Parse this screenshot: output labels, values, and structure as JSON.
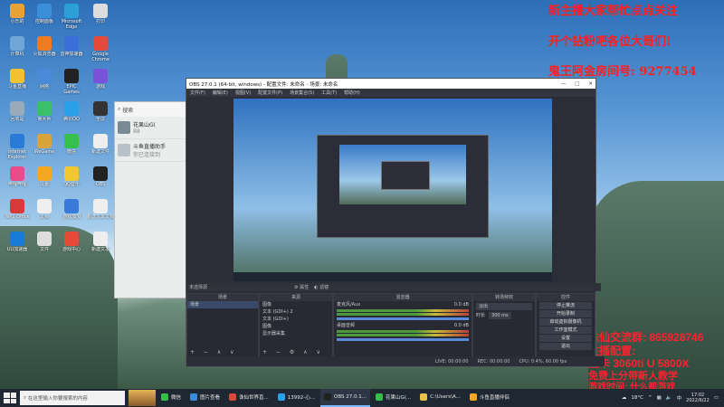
{
  "desktop": {
    "icons": [
      {
        "label": "小乐的",
        "color": "#e8a23a"
      },
      {
        "label": "控制面板",
        "color": "#3a8fd8"
      },
      {
        "label": "Microsoft Edge",
        "color": "#2c9fd8"
      },
      {
        "label": "打印",
        "color": "#ddd"
      },
      {
        "label": "计算机",
        "color": "#6fa6d8"
      },
      {
        "label": "火狐浏览器",
        "color": "#f07a22"
      },
      {
        "label": "雷神加速器",
        "color": "#3b6ed8"
      },
      {
        "label": "Google Chrome",
        "color": "#e64a3b"
      },
      {
        "label": "斗鱼直播",
        "color": "#f2c230"
      },
      {
        "label": "网络",
        "color": "#4a8ad8"
      },
      {
        "label": "EPIC Games Launcher",
        "color": "#222"
      },
      {
        "label": "游戏",
        "color": "#7a52d8"
      },
      {
        "label": "回收站",
        "color": "#9ab"
      },
      {
        "label": "鲁大师",
        "color": "#3ac06a"
      },
      {
        "label": "腾讯QQ",
        "color": "#2aa0e8"
      },
      {
        "label": "全屏",
        "color": "#333"
      },
      {
        "label": "Internet Explorer",
        "color": "#2a7ad8"
      },
      {
        "label": "WeGame",
        "color": "#d8a33a"
      },
      {
        "label": "微信",
        "color": "#36c04a"
      },
      {
        "label": "新建文件",
        "color": "#eee"
      },
      {
        "label": "哔哩哔哩",
        "color": "#e84a8a"
      },
      {
        "label": "斗鱼",
        "color": "#f5a623"
      },
      {
        "label": "QQ音乐",
        "color": "#f2c730"
      },
      {
        "label": "OBS",
        "color": "#222"
      },
      {
        "label": "WPS Office",
        "color": "#d83a3a"
      },
      {
        "label": "文档",
        "color": "#eee"
      },
      {
        "label": "游戏加加",
        "color": "#3a7ad8"
      },
      {
        "label": "新建文本文档",
        "color": "#eee"
      },
      {
        "label": "UU加速器",
        "color": "#1a7ad8"
      },
      {
        "label": "文件",
        "color": "#ddd"
      },
      {
        "label": "游戏中心",
        "color": "#e84a3a"
      },
      {
        "label": "新建文本",
        "color": "#eee"
      }
    ],
    "overlay_lines": [
      "新主播大家帮忙点点关注",
      "开个钻粉吧各位大哥们!",
      "鬼王阿金房间号: 9277454"
    ],
    "overlay_bottom": [
      "诛仙交流群: 865928746",
      "主播配置:",
      "显卡 3060ti U 5800X",
      "免费上分带新人教学",
      "游戏时间: 什么都游戏"
    ]
  },
  "chat_window": {
    "search_placeholder": "搜索",
    "items": [
      {
        "name": "花果山G(",
        "msg": "88"
      },
      {
        "name": "斗鱼直播助手",
        "msg": "你已连接到"
      }
    ]
  },
  "obs": {
    "title": "OBS 27.0.1 (64-bit, windows) - 配置文件: 未命名 - 场景: 未命名",
    "window_controls": [
      "—",
      "□",
      "✕"
    ],
    "menu": [
      "文件(F)",
      "编辑(E)",
      "视图(V)",
      "配置文件(P)",
      "场景集合(S)",
      "工具(T)",
      "帮助(H)"
    ],
    "source_bar": [
      "未选择源",
      "属性",
      "滤镜"
    ],
    "docks": {
      "scenes": {
        "title": "场景",
        "items": [
          "场景"
        ]
      },
      "sources": {
        "title": "来源",
        "items": [
          "图像",
          "文本 (GDI+) 2",
          "文本 (GDI+)",
          "图像",
          "显示器采集"
        ]
      },
      "mixer": {
        "title": "混音器",
        "channels": [
          {
            "name": "麦克风/Aux",
            "db": "0.0 dB"
          },
          {
            "name": "桌面音频",
            "db": "0.0 dB"
          }
        ]
      },
      "transitions": {
        "title": "转场特效",
        "type": "淡出",
        "duration_label": "时长",
        "duration": "300 ms"
      },
      "controls": {
        "title": "控件",
        "buttons": [
          "停止推流",
          "开始录制",
          "启动虚拟摄像机",
          "工作室模式",
          "设置",
          "退出"
        ]
      }
    },
    "status": [
      "LIVE: 00:00:00",
      "REC: 00:00:00",
      "CPU: 0.4%, 60.00 fps"
    ]
  },
  "taskbar": {
    "search_placeholder": "在这里输入你要搜索的内容",
    "apps": [
      {
        "label": "微信",
        "color": "#36c04a",
        "active": false
      },
      {
        "label": "图片查看",
        "color": "#3a8ad8",
        "active": false
      },
      {
        "label": "诛仙世界直...",
        "color": "#d84a3a",
        "active": false
      },
      {
        "label": "13992-心...",
        "color": "#2aa0e8",
        "active": false
      },
      {
        "label": "OBS 27.0.1...",
        "color": "#222",
        "active": true
      },
      {
        "label": "花果山G(...",
        "color": "#36c04a",
        "active": false
      },
      {
        "label": "C:\\Users\\A...",
        "color": "#e8c24a",
        "active": false
      },
      {
        "label": "斗鱼直播伴侣",
        "color": "#f5a623",
        "active": false
      }
    ],
    "weather": "18°C",
    "lang": "中",
    "time": "17:02",
    "date": "2022/6/22"
  }
}
